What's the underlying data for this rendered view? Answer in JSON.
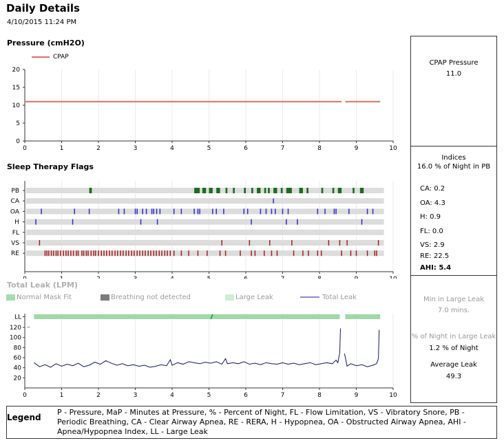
{
  "header": {
    "title": "Daily Details",
    "datetime": "4/10/2015 11:24 PM"
  },
  "sections": {
    "pressure_title": "Pressure (cmH2O)",
    "flags_title": "Sleep Therapy Flags",
    "leak_title": "Total Leak (LPM)"
  },
  "colors": {
    "cpap": "#d2706e",
    "flag_pb": "#1e6b1e",
    "flag_blue": "#2c2cc8",
    "flag_red": "#a41e1e",
    "leak_line": "#14145a",
    "large_leak": "#9fd9a8",
    "normal_mask": "#a6dcae",
    "breath_nd": "#7d7d7d",
    "flag_track": "#dcdcdc"
  },
  "chart_data": [
    {
      "type": "line",
      "title": "Pressure (cmH2O)",
      "legend": [
        "CPAP"
      ],
      "legend_position": "top-left",
      "x_ticks": [
        "0",
        "1",
        "2",
        "3",
        "4",
        "5",
        "6",
        "7",
        "8",
        "9",
        "10"
      ],
      "y_ticks": [
        "0",
        "5",
        "10",
        "15",
        "20"
      ],
      "xlim": [
        0,
        10
      ],
      "ylim": [
        0,
        20
      ],
      "grid": true,
      "series": [
        {
          "name": "CPAP",
          "segments": [
            {
              "x": [
                0,
                8.6
              ],
              "y": [
                11,
                11
              ]
            },
            {
              "x": [
                8.7,
                9.65
              ],
              "y": [
                11,
                11
              ]
            }
          ]
        }
      ]
    },
    {
      "type": "scatter",
      "title": "Sleep Therapy Flags",
      "x_ticks": [
        "0",
        "1",
        "2",
        "3",
        "4",
        "5",
        "6",
        "7",
        "8",
        "9",
        "10"
      ],
      "xlim": [
        0,
        10
      ],
      "grid": true,
      "categories": [
        "PB",
        "CA",
        "OA",
        "H",
        "FL",
        "VS",
        "RE"
      ],
      "tracks": {
        "PB": [
          [
            1.75,
            1.82
          ],
          [
            4.6,
            4.75
          ],
          [
            4.82,
            4.92
          ],
          [
            5.0,
            5.1
          ],
          [
            5.2,
            5.3
          ],
          [
            5.45,
            5.5
          ],
          [
            5.65,
            5.7
          ],
          [
            5.95,
            6.0
          ],
          [
            6.15,
            6.2
          ],
          [
            6.3,
            6.4
          ],
          [
            6.5,
            6.55
          ],
          [
            6.6,
            6.65
          ],
          [
            6.75,
            6.85
          ],
          [
            6.95,
            7.0
          ],
          [
            7.1,
            7.25
          ],
          [
            7.45,
            7.55
          ],
          [
            7.65,
            7.7
          ],
          [
            8.05,
            8.1
          ],
          [
            8.35,
            8.4
          ],
          [
            8.5,
            8.6
          ],
          [
            8.9,
            8.95
          ],
          [
            9.1,
            9.2
          ]
        ],
        "CA": [
          6.75
        ],
        "OA": [
          0.45,
          1.35,
          1.75,
          2.55,
          2.7,
          3.0,
          3.05,
          3.2,
          3.3,
          3.45,
          3.5,
          3.58,
          3.67,
          4.05,
          4.25,
          4.6,
          4.7,
          4.75,
          5.1,
          5.2,
          5.4,
          5.95,
          6.05,
          6.4,
          6.55,
          6.7,
          6.8,
          7.0,
          7.15,
          7.95,
          8.15,
          8.4,
          8.45,
          8.8,
          9.3,
          9.45
        ],
        "H": [
          0.3,
          1.3,
          3.15,
          3.6,
          6.15,
          7.1,
          7.4,
          9.15
        ],
        "FL": [],
        "VS": [
          0.4,
          5.35,
          6.1,
          6.65,
          7.25,
          8.25,
          8.55,
          8.75,
          9.6
        ],
        "RE": [
          0.55,
          0.6,
          0.65,
          0.72,
          0.78,
          0.85,
          0.9,
          0.97,
          1.05,
          1.12,
          1.18,
          1.25,
          1.32,
          1.4,
          1.45,
          1.55,
          1.6,
          1.67,
          1.72,
          1.8,
          1.87,
          1.92,
          2.0,
          2.08,
          2.15,
          2.22,
          2.3,
          2.37,
          2.45,
          2.52,
          2.6,
          2.67,
          2.75,
          2.82,
          2.9,
          2.97,
          3.05,
          3.12,
          3.2,
          3.27,
          3.35,
          3.42,
          3.5,
          3.57,
          3.65,
          3.72,
          3.8,
          3.87,
          3.95,
          4.05,
          4.25,
          4.45,
          4.7,
          4.95,
          5.3,
          5.45,
          5.85,
          6.15,
          6.25,
          6.5,
          6.7,
          6.85,
          7.3,
          7.55,
          7.7,
          7.95,
          8.05,
          8.6,
          8.85,
          9.0,
          9.3,
          9.5,
          9.55
        ]
      }
    },
    {
      "type": "line",
      "title": "Total Leak (LPM)",
      "legend": [
        "Normal Mask Fit",
        "Breathing not detected",
        "Large Leak",
        "Total Leak"
      ],
      "legend_position": "top",
      "x_ticks": [
        "0",
        "1",
        "2",
        "3",
        "4",
        "5",
        "6",
        "7",
        "8",
        "9",
        "10"
      ],
      "y_ticks": [
        "20",
        "40",
        "60",
        "80",
        "100",
        "120",
        "LL"
      ],
      "xlim": [
        0,
        10
      ],
      "ylim": [
        0,
        132
      ],
      "grid": true,
      "large_leak_band": [
        [
          0.25,
          8.55
        ],
        [
          8.7,
          9.65
        ]
      ],
      "series": [
        {
          "name": "Total Leak",
          "segments": [
            {
              "x": [
                0.25,
                0.4,
                0.55,
                0.7,
                0.85,
                1.0,
                1.15,
                1.3,
                1.45,
                1.6,
                1.75,
                1.9,
                2.05,
                2.2,
                2.35,
                2.5,
                2.65,
                2.8,
                2.95,
                3.1,
                3.25,
                3.4,
                3.55,
                3.7,
                3.85,
                3.95,
                4.0,
                4.15,
                4.3,
                4.45,
                4.6,
                4.75,
                4.9,
                5.05,
                5.2,
                5.35,
                5.45,
                5.5,
                5.65,
                5.8,
                5.95,
                6.1,
                6.25,
                6.4,
                6.55,
                6.7,
                6.85,
                7.0,
                7.15,
                7.3,
                7.45,
                7.6,
                7.75,
                7.9,
                8.05,
                8.2,
                8.35,
                8.45,
                8.5,
                8.55,
                8.57
              ],
              "y": [
                50,
                42,
                46,
                41,
                48,
                43,
                47,
                44,
                49,
                42,
                45,
                51,
                47,
                54,
                49,
                45,
                48,
                44,
                46,
                43,
                45,
                41,
                43,
                46,
                44,
                56,
                45,
                50,
                47,
                52,
                50,
                48,
                51,
                49,
                52,
                47,
                58,
                48,
                50,
                48,
                52,
                47,
                49,
                46,
                50,
                48,
                47,
                50,
                47,
                49,
                46,
                48,
                50,
                46,
                48,
                50,
                48,
                55,
                50,
                70,
                118
              ]
            },
            {
              "x": [
                8.68,
                8.75,
                8.85,
                9.0,
                9.15,
                9.3,
                9.45,
                9.55,
                9.6,
                9.62
              ],
              "y": [
                68,
                43,
                48,
                44,
                46,
                42,
                45,
                48,
                58,
                115
              ]
            }
          ]
        }
      ]
    }
  ],
  "sidebar": {
    "pressure": {
      "label": "CPAP Pressure",
      "value": "11.0"
    },
    "indices": {
      "heading": "Indices",
      "pb_line": "16.0 % of Night in PB",
      "rows": [
        {
          "label": "CA:",
          "value": "0.2"
        },
        {
          "label": "OA:",
          "value": "4.3"
        },
        {
          "label": "H:",
          "value": "0.9"
        },
        {
          "label": "FL:",
          "value": "0.0"
        },
        {
          "label": "VS:",
          "value": "2.9"
        },
        {
          "label": "RE:",
          "value": "22.5"
        },
        {
          "label": "AHI:",
          "value": "5.4"
        }
      ]
    },
    "leak": {
      "min_label": "Min in Large Leak",
      "min_value": "7.0 mins.",
      "pct_label": "% of Night in Large Leak",
      "pct_value": "1.2 % of Night",
      "avg_label": "Average Leak",
      "avg_value": "49.3"
    }
  },
  "legend": {
    "label": "Legend",
    "text": "P - Pressure, MaP - Minutes at Pressure, % - Percent of Night, FL - Flow Limitation, VS - Vibratory Snore, PB - Periodic Breathing, CA - Clear Airway Apnea, RE - RERA, H - Hypopnea, OA - Obstructed Airway Apnea, AHI - Apnea/Hypopnea Index, LL - Large Leak"
  }
}
